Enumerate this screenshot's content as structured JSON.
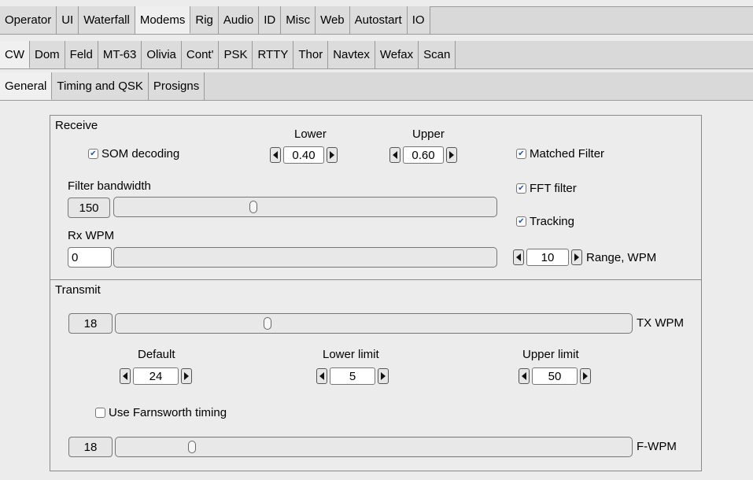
{
  "tabs_main": [
    "Operator",
    "UI",
    "Waterfall",
    "Modems",
    "Rig",
    "Audio",
    "ID",
    "Misc",
    "Web",
    "Autostart",
    "IO"
  ],
  "tabs_modem": [
    "CW",
    "Dom",
    "Feld",
    "MT-63",
    "Olivia",
    "Cont'",
    "PSK",
    "RTTY",
    "Thor",
    "Navtex",
    "Wefax",
    "Scan"
  ],
  "tabs_cw": [
    "General",
    "Timing and QSK",
    "Prosigns"
  ],
  "receive": {
    "title": "Receive",
    "som_label": "SOM decoding",
    "som_checked": true,
    "lower_label": "Lower",
    "lower_value": "0.40",
    "upper_label": "Upper",
    "upper_value": "0.60",
    "matched_label": "Matched Filter",
    "matched_checked": true,
    "fft_label": "FFT filter",
    "fft_checked": true,
    "tracking_label": "Tracking",
    "tracking_checked": true,
    "filter_bw_label": "Filter bandwidth",
    "filter_bw_value": "150",
    "filter_bw_fraction": 0.36,
    "rxwpm_label": "Rx WPM",
    "rxwpm_value": "0",
    "range_value": "10",
    "range_label": "Range, WPM"
  },
  "transmit": {
    "title": "Transmit",
    "txwpm_value": "18",
    "txwpm_fraction": 0.29,
    "txwpm_label": "TX WPM",
    "default_label": "Default",
    "default_value": "24",
    "lower_limit_label": "Lower limit",
    "lower_limit_value": "5",
    "upper_limit_label": "Upper limit",
    "upper_limit_value": "50",
    "farnsworth_label": "Use Farnsworth timing",
    "farnsworth_checked": false,
    "fwpm_value": "18",
    "fwpm_fraction": 0.14,
    "fwpm_label": "F-WPM"
  }
}
